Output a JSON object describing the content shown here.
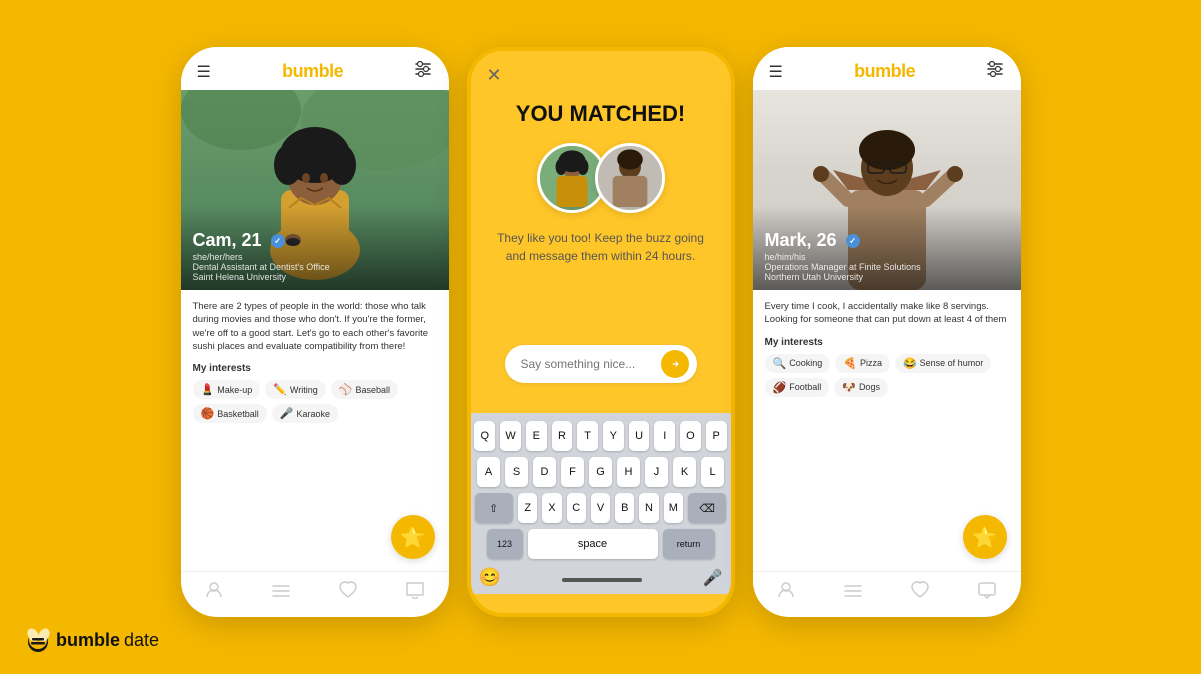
{
  "background": "#F5B800",
  "brand": {
    "name": "bumble",
    "suffix": "date",
    "logo_alt": "bumble-logo"
  },
  "phone_left": {
    "header": {
      "menu_icon": "☰",
      "logo": "bumble",
      "filter_icon": "⚙"
    },
    "profile": {
      "name": "Cam, 21",
      "verified": true,
      "pronouns": "she/her/hers",
      "job": "Dental Assistant at Dentist's Office",
      "school": "Saint Helena University",
      "bio": "There are 2 types of people in the world: those who talk during movies and those who don't. If you're the former, we're off to a good start. Let's go to each other's favorite sushi places and evaluate compatibility from there!",
      "interests_title": "My interests",
      "interests": [
        {
          "emoji": "💄",
          "label": "Make-up"
        },
        {
          "emoji": "✏️",
          "label": "Writing"
        },
        {
          "emoji": "⚾",
          "label": "Baseball"
        },
        {
          "emoji": "🏀",
          "label": "Basketball"
        },
        {
          "emoji": "🎤",
          "label": "Karaoke"
        }
      ]
    },
    "nav": [
      "👤",
      "≡",
      "♡",
      "💬"
    ],
    "star_btn": "⭐"
  },
  "phone_center": {
    "close_btn": "✕",
    "match_title": "YOU MATCHED!",
    "match_subtitle": "They like you too! Keep the buzz going and\nmessage them within 24 hours.",
    "message_placeholder": "Say something nice...",
    "keyboard": {
      "row1": [
        "Q",
        "W",
        "E",
        "R",
        "T",
        "Y",
        "U",
        "I",
        "O",
        "P"
      ],
      "row2": [
        "A",
        "S",
        "D",
        "F",
        "G",
        "H",
        "J",
        "K",
        "L"
      ],
      "row3": [
        "Z",
        "X",
        "C",
        "V",
        "B",
        "N",
        "M"
      ],
      "bottom": {
        "nums": "123",
        "space": "space",
        "return": "return"
      }
    }
  },
  "phone_right": {
    "header": {
      "menu_icon": "☰",
      "logo": "bumble",
      "filter_icon": "⚙"
    },
    "profile": {
      "name": "Mark, 26",
      "verified": true,
      "pronouns": "he/him/his",
      "job": "Operations Manager at Finite Solutions",
      "school": "Northern Utah University",
      "bio": "Every time I cook, I accidentally make like 8 servings. Looking for someone that can put down at least 4 of them",
      "interests_title": "My interests",
      "interests": [
        {
          "emoji": "🔍",
          "label": "Cooking"
        },
        {
          "emoji": "🍕",
          "label": "Pizza"
        },
        {
          "emoji": "😂",
          "label": "Sense of humor"
        },
        {
          "emoji": "🏈",
          "label": "Football"
        },
        {
          "emoji": "🐶",
          "label": "Dogs"
        }
      ]
    },
    "nav": [
      "👤",
      "≡",
      "♡",
      "💬"
    ],
    "star_btn": "⭐"
  }
}
